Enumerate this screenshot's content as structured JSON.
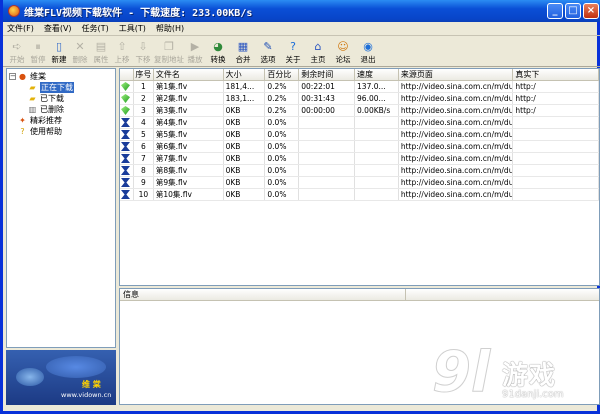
{
  "window": {
    "title": "维棠FLV视频下载软件 - 下载速度: 233.00KB/s",
    "buttons": {
      "minimize": "_",
      "maximize": "□",
      "close": "×"
    }
  },
  "menu": [
    "文件(F)",
    "查看(V)",
    "任务(T)",
    "工具(T)",
    "帮助(H)"
  ],
  "toolbar": [
    {
      "label": "开始",
      "icon": "play-icon",
      "enabled": false
    },
    {
      "label": "暂停",
      "icon": "pause-icon",
      "enabled": false
    },
    {
      "label": "新建",
      "icon": "new-icon",
      "enabled": true
    },
    {
      "label": "删除",
      "icon": "delete-icon",
      "enabled": false
    },
    {
      "label": "属性",
      "icon": "properties-icon",
      "enabled": false
    },
    {
      "label": "上移",
      "icon": "move-up-icon",
      "enabled": false
    },
    {
      "label": "下移",
      "icon": "move-down-icon",
      "enabled": false
    },
    {
      "label": "复制地址",
      "icon": "copy-icon",
      "enabled": false
    },
    {
      "label": "播放",
      "icon": "video-icon",
      "enabled": false
    },
    {
      "label": "转换",
      "icon": "convert-icon",
      "enabled": true
    },
    {
      "label": "合并",
      "icon": "merge-icon",
      "enabled": true
    },
    {
      "label": "选项",
      "icon": "options-icon",
      "enabled": true
    },
    {
      "label": "关于",
      "icon": "about-icon",
      "enabled": true
    },
    {
      "label": "主页",
      "icon": "home-icon",
      "enabled": true
    },
    {
      "label": "论坛",
      "icon": "forum-icon",
      "enabled": true
    },
    {
      "label": "退出",
      "icon": "exit-icon",
      "enabled": true
    }
  ],
  "tree": {
    "root": "维棠",
    "children": [
      "正在下载",
      "已下载",
      "已删除"
    ],
    "others": [
      "精彩推荐",
      "使用帮助"
    ]
  },
  "banner": {
    "logo": "维 棠",
    "url": "www.vidown.cn"
  },
  "grid": {
    "columns": [
      "",
      "序号",
      "文件名",
      "大小",
      "百分比",
      "剩余时间",
      "速度",
      "来源页面",
      "真实下"
    ],
    "rows": [
      {
        "status": "done",
        "no": "1",
        "name": "第1集.flv",
        "size": "181,4...",
        "pct": "0.2%",
        "remain": "00:22:01",
        "speed": "137.0...",
        "source": "http://video.sina.com.cn/m/duan...",
        "real": "http:/"
      },
      {
        "status": "done",
        "no": "2",
        "name": "第2集.flv",
        "size": "183,1...",
        "pct": "0.2%",
        "remain": "00:31:43",
        "speed": "96.00...",
        "source": "http://video.sina.com.cn/m/duan...",
        "real": "http:/"
      },
      {
        "status": "done",
        "no": "3",
        "name": "第3集.flv",
        "size": "0KB",
        "pct": "0.2%",
        "remain": "00:00:00",
        "speed": "0.00KB/s",
        "source": "http://video.sina.com.cn/m/duan...",
        "real": "http:/"
      },
      {
        "status": "wait",
        "no": "4",
        "name": "第4集.flv",
        "size": "0KB",
        "pct": "0.0%",
        "remain": "",
        "speed": "",
        "source": "http://video.sina.com.cn/m/duan...",
        "real": ""
      },
      {
        "status": "wait",
        "no": "5",
        "name": "第5集.flv",
        "size": "0KB",
        "pct": "0.0%",
        "remain": "",
        "speed": "",
        "source": "http://video.sina.com.cn/m/duan...",
        "real": ""
      },
      {
        "status": "wait",
        "no": "6",
        "name": "第6集.flv",
        "size": "0KB",
        "pct": "0.0%",
        "remain": "",
        "speed": "",
        "source": "http://video.sina.com.cn/m/duan...",
        "real": ""
      },
      {
        "status": "wait",
        "no": "7",
        "name": "第7集.flv",
        "size": "0KB",
        "pct": "0.0%",
        "remain": "",
        "speed": "",
        "source": "http://video.sina.com.cn/m/duan...",
        "real": ""
      },
      {
        "status": "wait",
        "no": "8",
        "name": "第8集.flv",
        "size": "0KB",
        "pct": "0.0%",
        "remain": "",
        "speed": "",
        "source": "http://video.sina.com.cn/m/duan...",
        "real": ""
      },
      {
        "status": "wait",
        "no": "9",
        "name": "第9集.flv",
        "size": "0KB",
        "pct": "0.0%",
        "remain": "",
        "speed": "",
        "source": "http://video.sina.com.cn/m/duan...",
        "real": ""
      },
      {
        "status": "wait",
        "no": "10",
        "name": "第10集.flv",
        "size": "0KB",
        "pct": "0.0%",
        "remain": "",
        "speed": "",
        "source": "http://video.sina.com.cn/m/duan...",
        "real": ""
      }
    ]
  },
  "info": {
    "header": "信息"
  },
  "watermark": {
    "digits": "9l",
    "text": "游戏",
    "url": "91danji.com"
  },
  "colors": {
    "title_bar": "#0a4fd6",
    "selection": "#316ac5",
    "banner": "#1c3a84"
  }
}
